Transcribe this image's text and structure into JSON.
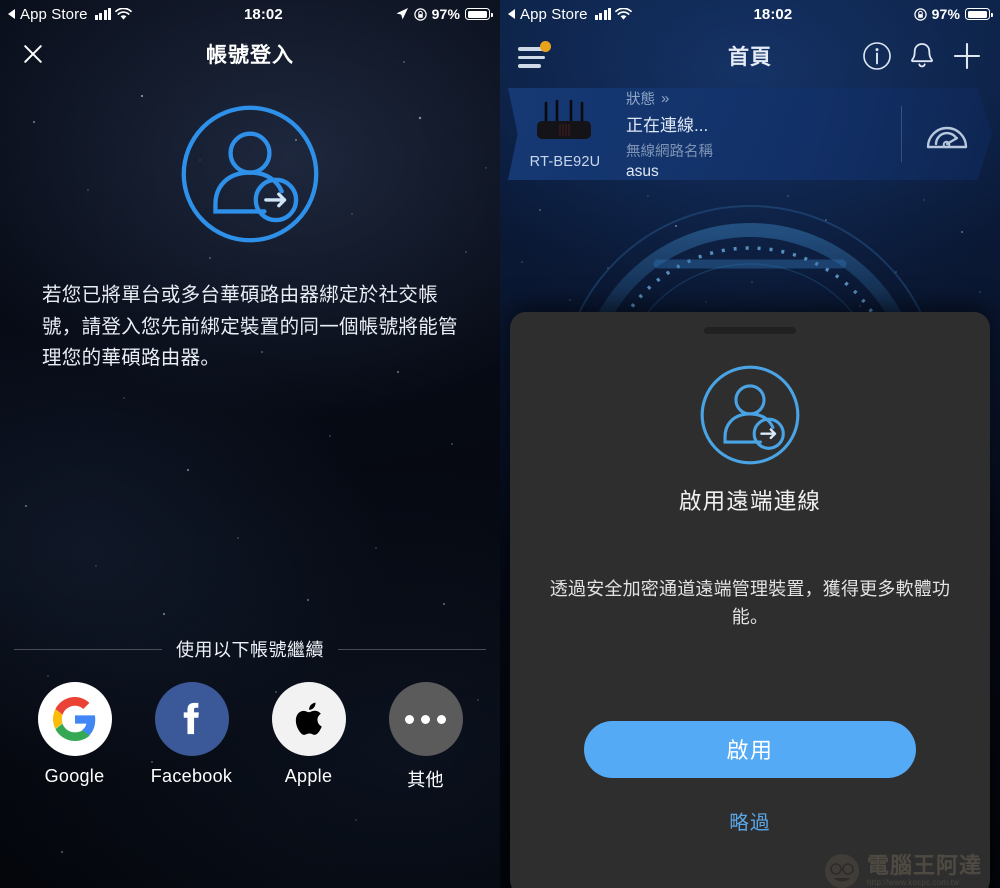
{
  "left_screen": {
    "statusbar": {
      "back_app": "App Store",
      "time": "18:02",
      "battery_pct": "97%",
      "icons": [
        "back-triangle-icon",
        "signal-bars-icon",
        "wifi-icon",
        "location-arrow-icon",
        "rotation-lock-icon",
        "battery-icon"
      ]
    },
    "navbar": {
      "close_icon": "close-x-icon",
      "title": "帳號登入"
    },
    "hero_icon": "user-login-icon",
    "intro_text": "若您已將單台或多台華碩路由器綁定於社交帳號，請登入您先前綁定裝置的同一個帳號將能管理您的華碩路由器。",
    "divider_label": "使用以下帳號繼續",
    "providers": [
      {
        "id": "google",
        "label": "Google",
        "icon": "google-icon"
      },
      {
        "id": "facebook",
        "label": "Facebook",
        "icon": "facebook-icon"
      },
      {
        "id": "apple",
        "label": "Apple",
        "icon": "apple-icon"
      },
      {
        "id": "other",
        "label": "其他",
        "icon": "ellipsis-icon"
      }
    ]
  },
  "right_screen": {
    "statusbar": {
      "back_app": "App Store",
      "time": "18:02",
      "battery_pct": "97%",
      "icons": [
        "back-triangle-icon",
        "signal-bars-icon",
        "wifi-icon",
        "rotation-lock-icon",
        "battery-icon"
      ]
    },
    "navbar": {
      "menu_icon": "hamburger-menu-icon",
      "menu_badge": true,
      "title": "首頁",
      "actions": [
        {
          "id": "info",
          "icon": "info-circle-icon"
        },
        {
          "id": "alerts",
          "icon": "bell-icon"
        },
        {
          "id": "add",
          "icon": "plus-icon"
        }
      ]
    },
    "device_card": {
      "device_name": "RT-BE92U",
      "device_icon": "router-icon",
      "status_label": "狀態",
      "status_chevron": "»",
      "status_value": "正在連線...",
      "ssid_label": "無線網路名稱",
      "ssid_value": "asus",
      "speed_icon": "speedometer-icon"
    },
    "sheet": {
      "grabber": "drag-handle",
      "icon": "user-login-icon",
      "title": "啟用遠端連線",
      "description": "透過安全加密通道遠端管理裝置，獲得更多軟體功能。",
      "primary_button": "啟用",
      "secondary_link": "略過",
      "accent_color": "#55aaf5",
      "link_color": "#5aa7e8",
      "background_color": "#2e2e2e"
    },
    "watermark": {
      "name": "電腦王阿達",
      "url": "http://www.kocpc.com.tw"
    }
  }
}
